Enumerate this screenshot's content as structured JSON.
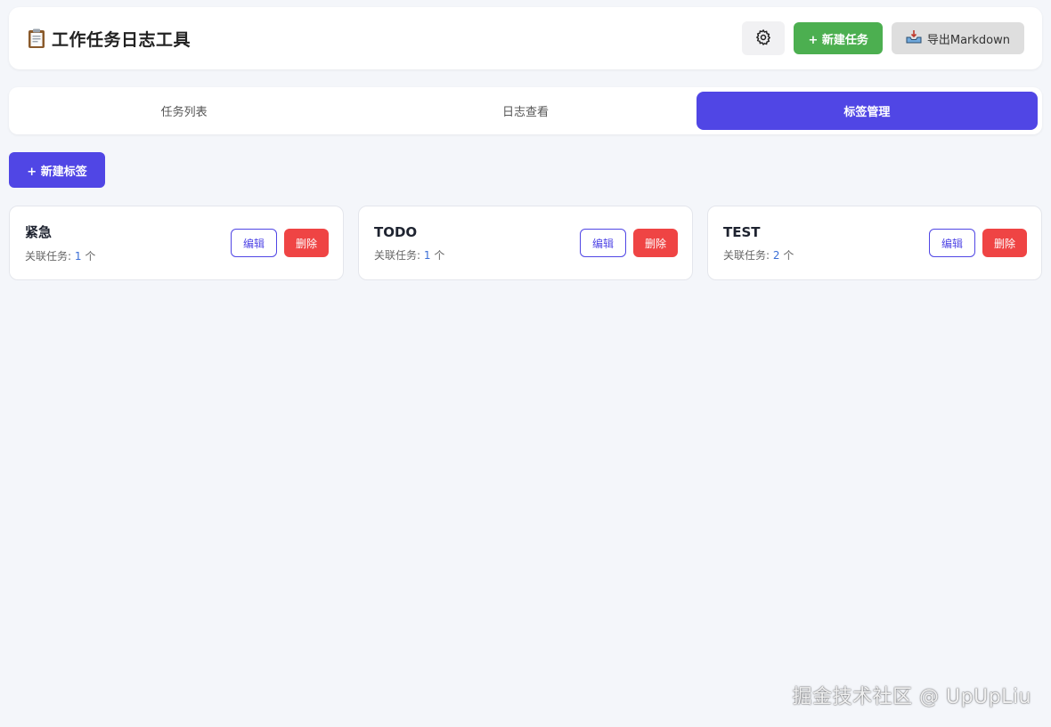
{
  "header": {
    "title": "工作任务日志工具",
    "title_icon": "clipboard-icon",
    "settings_icon": "gear-icon",
    "new_task_label": "+ 新建任务",
    "export_label": "导出Markdown",
    "export_icon": "inbox-tray-icon"
  },
  "tabs": [
    {
      "label": "任务列表",
      "active": false
    },
    {
      "label": "日志查看",
      "active": false
    },
    {
      "label": "标签管理",
      "active": true
    }
  ],
  "new_tag_label": "+ 新建标签",
  "tags": [
    {
      "name": "紧急",
      "meta_prefix": "关联任务: ",
      "count": "1",
      "meta_suffix": " 个"
    },
    {
      "name": "TODO",
      "meta_prefix": "关联任务: ",
      "count": "1",
      "meta_suffix": " 个"
    },
    {
      "name": "TEST",
      "meta_prefix": "关联任务: ",
      "count": "2",
      "meta_suffix": " 个"
    }
  ],
  "card_actions": {
    "edit_label": "编辑",
    "delete_label": "删除"
  },
  "watermark": "掘金技术社区 @ UpUpLiu",
  "colors": {
    "primary": "#5046e5",
    "success": "#4caf50",
    "danger": "#ef4444",
    "background": "#f4f6fa"
  }
}
